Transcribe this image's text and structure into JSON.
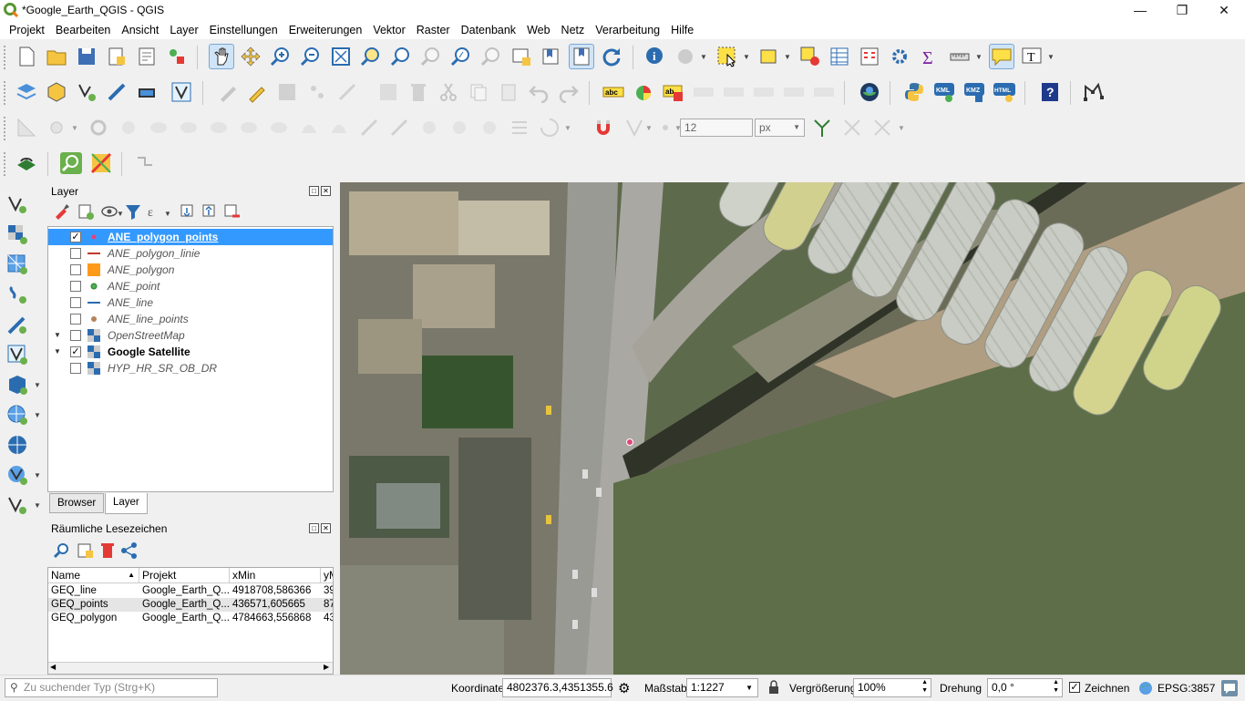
{
  "window": {
    "title": "*Google_Earth_QGIS - QGIS"
  },
  "menu": [
    "Projekt",
    "Bearbeiten",
    "Ansicht",
    "Layer",
    "Einstellungen",
    "Erweiterungen",
    "Vektor",
    "Raster",
    "Datenbank",
    "Web",
    "Netz",
    "Verarbeitung",
    "Hilfe"
  ],
  "snapping": {
    "tolerance": "12",
    "unit": "px"
  },
  "layers_panel": {
    "title": "Layer",
    "tabs": [
      "Browser",
      "Layer"
    ],
    "items": [
      {
        "name": "ANE_polygon_points",
        "checked": true,
        "selected": true
      },
      {
        "name": "ANE_polygon_linie",
        "checked": false
      },
      {
        "name": "ANE_polygon",
        "checked": false
      },
      {
        "name": "ANE_point",
        "checked": false
      },
      {
        "name": "ANE_line",
        "checked": false
      },
      {
        "name": "ANE_line_points",
        "checked": false
      },
      {
        "name": "OpenStreetMap",
        "checked": false
      },
      {
        "name": "Google Satellite",
        "checked": true
      },
      {
        "name": "HYP_HR_SR_OB_DR",
        "checked": false
      }
    ]
  },
  "bookmarks_panel": {
    "title": "Räumliche Lesezeichen",
    "columns": [
      "Name",
      "Projekt",
      "xMin",
      "yM"
    ],
    "rows": [
      [
        "GEQ_line",
        "Google_Earth_Q...",
        "4918708,586366",
        "39"
      ],
      [
        "GEQ_points",
        "Google_Earth_Q...",
        "436571,605665",
        "87"
      ],
      [
        "GEQ_polygon",
        "Google_Earth_Q...",
        "4784663,556868",
        "43"
      ]
    ]
  },
  "statusbar": {
    "search_placeholder": "Zu suchender Typ (Strg+K)",
    "coord_label": "Koordinate",
    "coord_value": "4802376.3,4351355.6",
    "scale_label": "Maßstab",
    "scale_value": "1:1227",
    "magnifier_label": "Vergrößerung",
    "magnifier_value": "100%",
    "rotation_label": "Drehung",
    "rotation_value": "0,0 °",
    "render_label": "Zeichnen",
    "crs": "EPSG:3857"
  },
  "colors": {
    "accent": "#0078d7",
    "selection": "#3399ff",
    "polygon_fill": "#ff9a1a",
    "point": "#e0457b"
  }
}
